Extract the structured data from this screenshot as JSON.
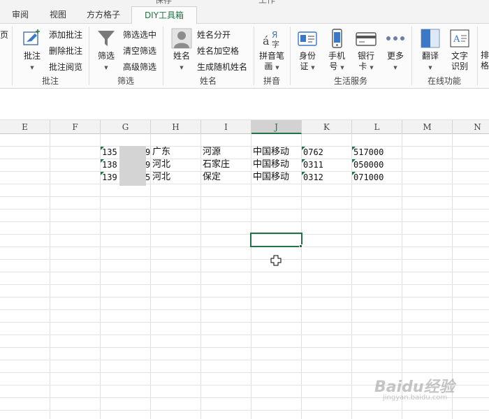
{
  "title_fragments": [
    "保存",
    "工作"
  ],
  "tabs": [
    {
      "label": "审阅"
    },
    {
      "label": "视图"
    },
    {
      "label": "方方格子"
    },
    {
      "label": "DIY工具箱"
    }
  ],
  "ribbon": {
    "page_fragment": "页",
    "comment_group": {
      "big_label": "批注",
      "items": [
        "添加批注",
        "删除批注",
        "批注阅览"
      ],
      "group_label": "批注"
    },
    "filter_group": {
      "big_label": "筛选",
      "items": [
        "筛选选中",
        "清空筛选",
        "高级筛选"
      ],
      "group_label": "筛选"
    },
    "name_group": {
      "big_label": "姓名",
      "items": [
        "姓名分开",
        "姓名加空格",
        "生成随机姓名"
      ],
      "group_label": "姓名"
    },
    "pinyin_group": {
      "big_label_line1": "拼音笔",
      "big_label_line2": "画",
      "group_label": "拼音"
    },
    "life_group": {
      "buttons": [
        {
          "line1": "身份",
          "line2": "证"
        },
        {
          "line1": "手机",
          "line2": "号"
        },
        {
          "line1": "银行",
          "line2": "卡"
        },
        {
          "line1": "更多",
          "line2": ""
        }
      ],
      "group_label": "生活服务"
    },
    "online_group": {
      "buttons": [
        {
          "line1": "翻译",
          "line2": ""
        },
        {
          "line1": "文字",
          "line2": "识别"
        }
      ],
      "group_label": "在线功能"
    },
    "cut_fragment": [
      "排",
      "格"
    ]
  },
  "columns": [
    "E",
    "F",
    "G",
    "H",
    "I",
    "J",
    "K",
    "L",
    "M",
    "N"
  ],
  "selected_column": "J",
  "rows": [
    {
      "G": "135",
      "G_tail": "9",
      "H": "广东",
      "I": "河源",
      "J": "中国移动",
      "K": "0762",
      "L": "517000"
    },
    {
      "G": "138",
      "G_tail": "9",
      "H": "河北",
      "I": "石家庄",
      "J": "中国移动",
      "K": "0311",
      "L": "050000"
    },
    {
      "G": "139",
      "G_tail": "5",
      "H": "河北",
      "I": "保定",
      "J": "中国移动",
      "K": "0312",
      "L": "071000"
    }
  ],
  "watermark": {
    "brand": "Baidu",
    "suffix": "经验",
    "url": "jingyan.baidu.com"
  }
}
